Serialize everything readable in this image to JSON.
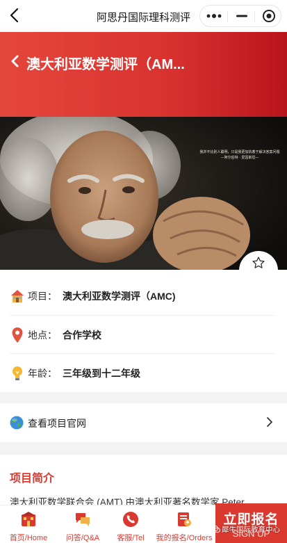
{
  "topbar": {
    "title": "阿思丹国际理科测评",
    "capsule": [
      "more-icon",
      "minimize-icon",
      "close-target-icon"
    ]
  },
  "header": {
    "title": "澳大利亚数学测评（AM..."
  },
  "photo": {
    "quote_line1": "我并不比别人聪明，只是我更加执着于解决答案问题",
    "quote_line2": "—阿尔伯特 · 爱因斯坦—"
  },
  "favorite": {
    "label": "收藏",
    "icon": "star-outline-icon"
  },
  "info": {
    "rows": [
      {
        "icon": "house-icon",
        "label": "项目：",
        "value": "澳大利亚数学测评（AMC)"
      },
      {
        "icon": "location-pin-icon",
        "label": "地点：",
        "value": "合作学校"
      },
      {
        "icon": "lightbulb-icon",
        "label": "年龄：",
        "value": "三年级到十二年级"
      }
    ]
  },
  "site": {
    "label": "查看项目官网",
    "icon": "globe-icon"
  },
  "intro": {
    "title": "项目简介",
    "text": "澳大利亚数学联合会 (AMT) 由澳大利亚著名数学家 Peter"
  },
  "tabbar": {
    "tabs": [
      {
        "label": "首页/Home",
        "icon": "home-icon"
      },
      {
        "label": "问答/Q&A",
        "icon": "chat-bubbles-icon"
      },
      {
        "label": "客服/Tel",
        "icon": "phone-icon"
      },
      {
        "label": "我的报名/Orders",
        "icon": "orders-icon"
      }
    ],
    "signup_cn": "立即报名",
    "signup_en": "SIGN UP"
  },
  "watermark": "犀牛国际教育中心",
  "colors": {
    "brand_red": "#d9392f",
    "header_gradient_start": "#e4473c",
    "header_gradient_end": "#b8141b"
  }
}
